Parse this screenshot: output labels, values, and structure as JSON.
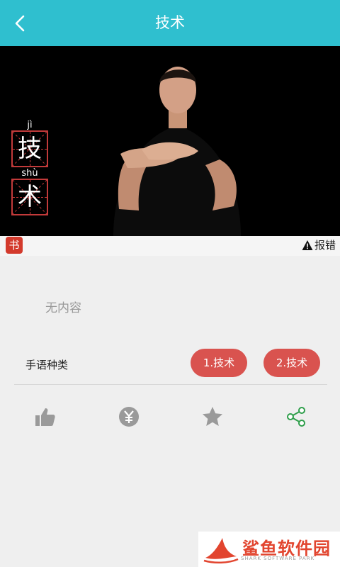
{
  "header": {
    "title": "技术"
  },
  "video": {
    "char1": {
      "pinyin": "jì",
      "hanzi": "技"
    },
    "char2": {
      "pinyin": "shù",
      "hanzi": "术"
    }
  },
  "infobar": {
    "book_glyph": "书",
    "report_label": "报错"
  },
  "content": {
    "empty_text": "无内容"
  },
  "sign_types": {
    "label": "手语种类",
    "options": [
      "1.技术",
      "2.技术"
    ]
  },
  "actions": [
    "thumbs-up-icon",
    "yuan-icon",
    "star-icon",
    "share-icon"
  ],
  "watermark": {
    "text": "鲨鱼软件园",
    "sub": "SHARK SOFTWARE PARK"
  },
  "colors": {
    "topbar": "#2fbfcf",
    "pill": "#d9534f",
    "share_green": "#2e9e4a",
    "icon_gray": "#9a9a9a"
  }
}
